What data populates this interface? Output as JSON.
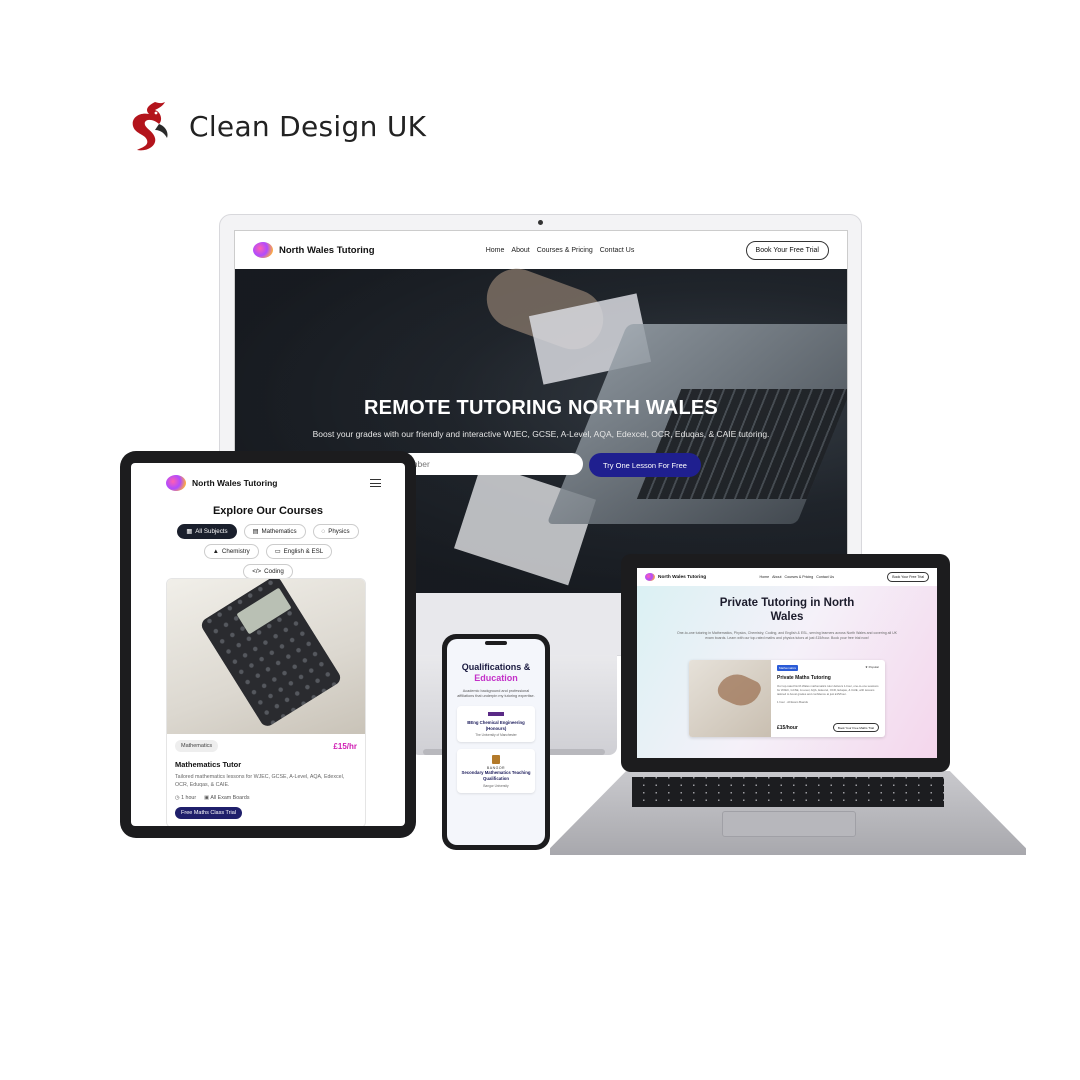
{
  "brand": {
    "name": "Clean Design UK",
    "logo_icon": "dragon-logo-icon",
    "logo_color": "#b3141c"
  },
  "desktop": {
    "nav": {
      "logo_text": "North Wales Tutoring",
      "links": [
        "Home",
        "About",
        "Courses & Pricing",
        "Contact Us"
      ],
      "cta": "Book Your Free Trial"
    },
    "hero": {
      "title": "REMOTE TUTORING NORTH WALES",
      "subtitle": "Boost your grades with our friendly and interactive WJEC, GCSE, A-Level, AQA, Edexcel, OCR, Eduqas, & CAIE tutoring.",
      "input_placeholder": "phone number",
      "button": "Try One Lesson For Free"
    },
    "accent_color": "#1f1f8f"
  },
  "tablet": {
    "logo_text": "North Wales Tutoring",
    "menu_icon": "hamburger-menu-icon",
    "heading": "Explore Our Courses",
    "chips": [
      {
        "label": "All Subjects",
        "icon": "▦",
        "active": true
      },
      {
        "label": "Mathematics",
        "icon": "▤",
        "active": false
      },
      {
        "label": "Physics",
        "icon": "◌",
        "active": false
      },
      {
        "label": "Chemistry",
        "icon": "▲",
        "active": false
      },
      {
        "label": "English & ESL",
        "icon": "▭",
        "active": false
      },
      {
        "label": "Coding",
        "icon": "</>",
        "active": false
      }
    ],
    "card": {
      "tag": "Mathematics",
      "price": "£15/hr",
      "title": "Mathematics Tutor",
      "description": "Tailored mathematics lessons for WJEC, GCSE, A-Level, AQA, Edexcel, OCR, Eduqas, & CAIE.",
      "duration": "1 hour",
      "boards": "All Exam Boards",
      "button": "Free Maths Class Trial"
    },
    "price_color": "#d01eb3"
  },
  "phone": {
    "title_line1": "Qualifications &",
    "title_line2": "Education",
    "subtitle": "Academic background and professional affiliations that underpin my tutoring expertise.",
    "cards": [
      {
        "degree": "BEng Chemical Engineering (Honours)",
        "institution": "The University of Manchester"
      },
      {
        "crest_text": "BANGOR",
        "degree": "Secondary Mathematics Teaching Qualification",
        "institution": "Bangor University"
      }
    ]
  },
  "laptop": {
    "nav": {
      "logo_text": "North Wales Tutoring",
      "links": [
        "Home",
        "About",
        "Courses & Pricing",
        "Contact Us"
      ],
      "cta": "Book Your Free Trial"
    },
    "title_line1": "Private Tutoring in North",
    "title_line2": "Wales",
    "subtitle": "One-to-one tutoring in Mathematics, Physics, Chemistry, Coding, and English & ESL, serving learners across North Wales and covering all UK exam boards. Learn with our top-rated maths and physics tutors at just £15/hour. Book your free trial now!",
    "card": {
      "badge": "Mathematics",
      "popular": "★ Popular",
      "title": "Private Maths Tutoring",
      "description": "Our top-rated North Wales mathematics tutor delivers 1-hour, one-to-one sessions for WJEC, GCSE, A-Level, AQA, Edexcel, OCR, Eduqas, & CAIE, with lessons tailored to boost grades and confidence at just £15/hour.",
      "meta": "1 hour · All Exam Boards",
      "price": "£15/hour",
      "button": "Book Your Free Maths Trial"
    }
  }
}
